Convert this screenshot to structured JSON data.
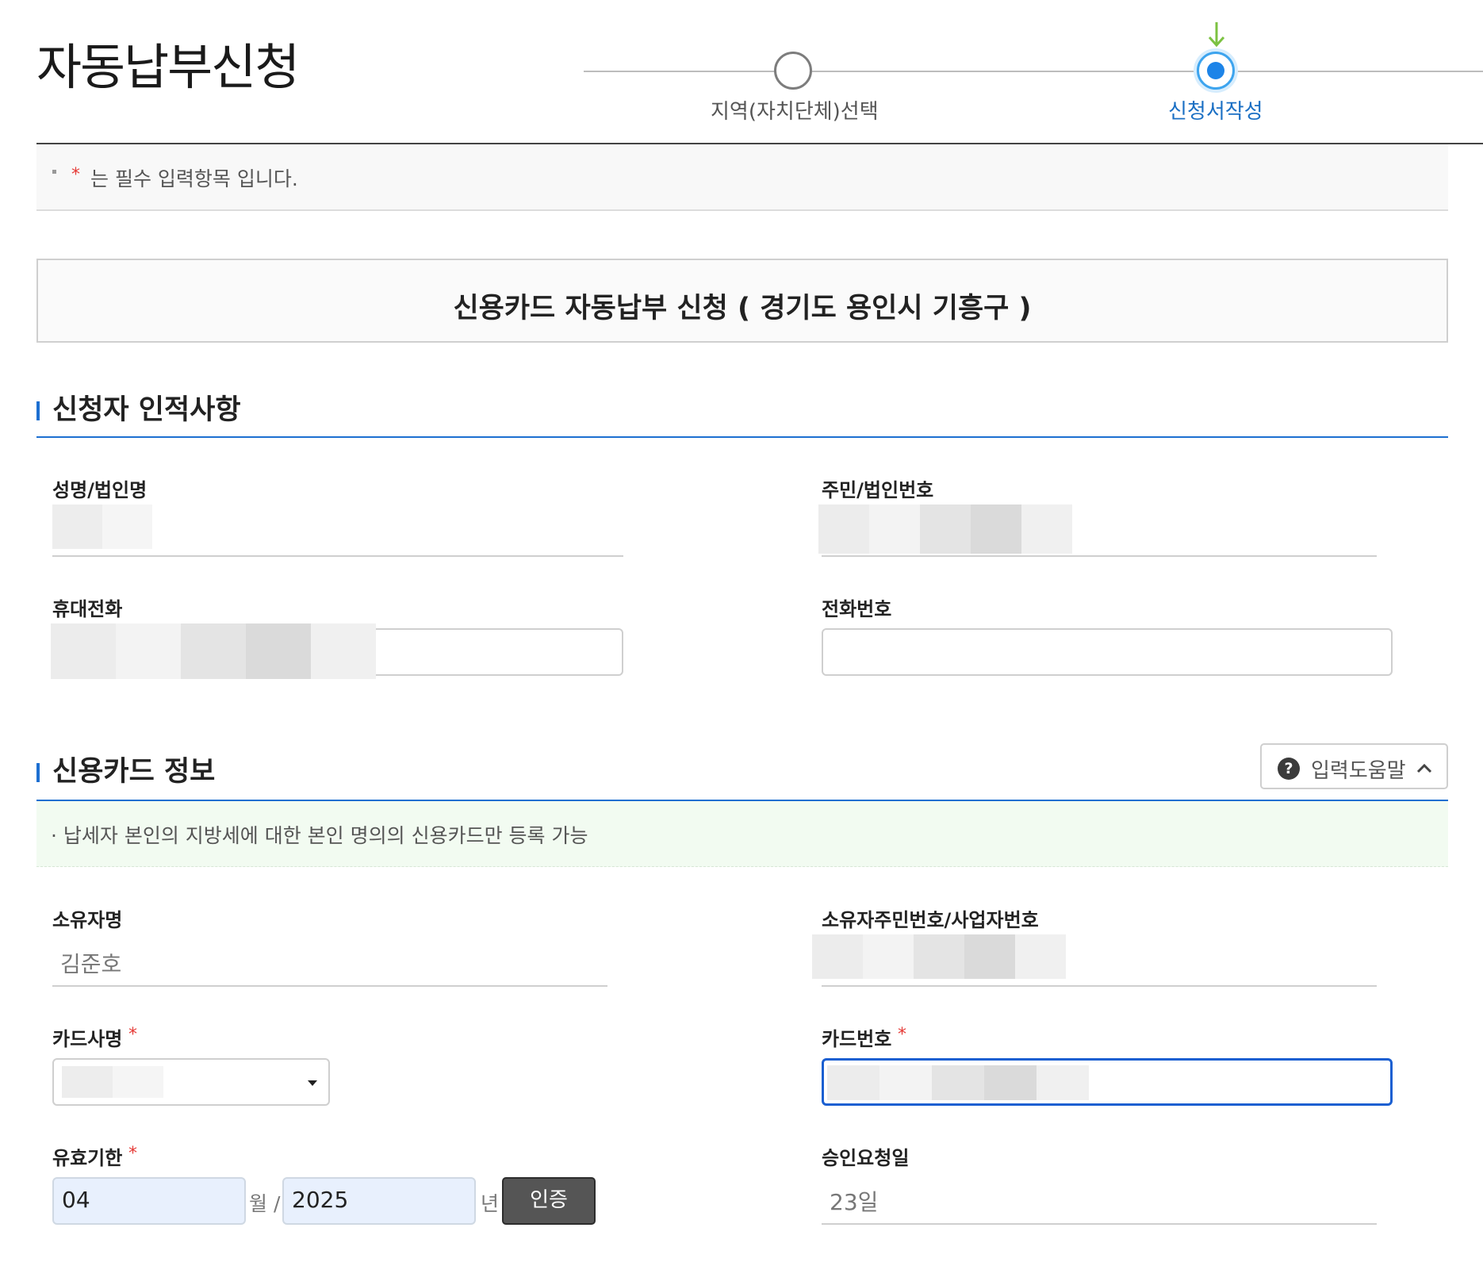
{
  "header": {
    "title": "자동납부신청",
    "steps": [
      {
        "label": "지역(자치단체)선택",
        "state": "done"
      },
      {
        "label": "신청서작성",
        "state": "current"
      }
    ]
  },
  "notice": {
    "required_mark": "*",
    "text": "는 필수 입력항목 입니다."
  },
  "form_title": "신용카드 자동납부 신청 ( 경기도  용인시 기흥구 )",
  "applicant": {
    "section_title": "신청자 인적사항",
    "name_label": "성명/법인명",
    "id_label": "주민/법인번호",
    "mobile_label": "휴대전화",
    "phone_label": "전화번호",
    "phone_value": ""
  },
  "card": {
    "section_title": "신용카드 정보",
    "help_label": "입력도움말",
    "info_text": "· 납세자 본인의 지방세에 대한 본인 명의의 신용카드만 등록 가능",
    "owner_label": "소유자명",
    "owner_value": "김준호",
    "owner_id_label": "소유자주민번호/사업자번호",
    "company_label": "카드사명",
    "number_label": "카드번호",
    "expiry_label": "유효기한",
    "expiry_month": "04",
    "month_unit": "월 /",
    "expiry_year": "2025",
    "year_unit": "년",
    "auth_button": "인증",
    "approval_label": "승인요청일",
    "approval_value": "23일"
  },
  "colors": {
    "accent_blue": "#1d6fd1",
    "required_red": "#e53935",
    "step_active": "#1d84e8",
    "info_bg": "#f2fbf1"
  }
}
